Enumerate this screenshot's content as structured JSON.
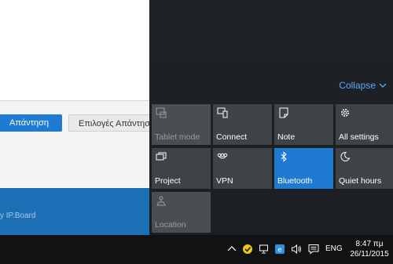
{
  "browser": {
    "reply_label": "Απάντηση",
    "options_label": "Επιλογές Απάντησης",
    "footer_text": "y IP.Board"
  },
  "action_center": {
    "collapse_label": "Collapse",
    "tiles": [
      {
        "label": "Tablet mode",
        "icon": "tablet-mode-icon",
        "state": "disabled"
      },
      {
        "label": "Connect",
        "icon": "connect-icon",
        "state": "off"
      },
      {
        "label": "Note",
        "icon": "note-icon",
        "state": "off"
      },
      {
        "label": "All settings",
        "icon": "gear-icon",
        "state": "off"
      },
      {
        "label": "Project",
        "icon": "project-icon",
        "state": "off"
      },
      {
        "label": "VPN",
        "icon": "vpn-icon",
        "state": "off"
      },
      {
        "label": "Bluetooth",
        "icon": "bluetooth-icon",
        "state": "on"
      },
      {
        "label": "Quiet hours",
        "icon": "moon-icon",
        "state": "off"
      },
      {
        "label": "Location",
        "icon": "location-icon",
        "state": "disabled"
      }
    ],
    "accent_color": "#1f7bd1"
  },
  "taskbar": {
    "tray_icons": [
      "chevron-up-icon",
      "norton-icon",
      "network-icon",
      "app-icon",
      "volume-icon",
      "action-center-icon"
    ],
    "language": "ENG",
    "time": "8:47 πμ",
    "date": "26/11/2015"
  }
}
